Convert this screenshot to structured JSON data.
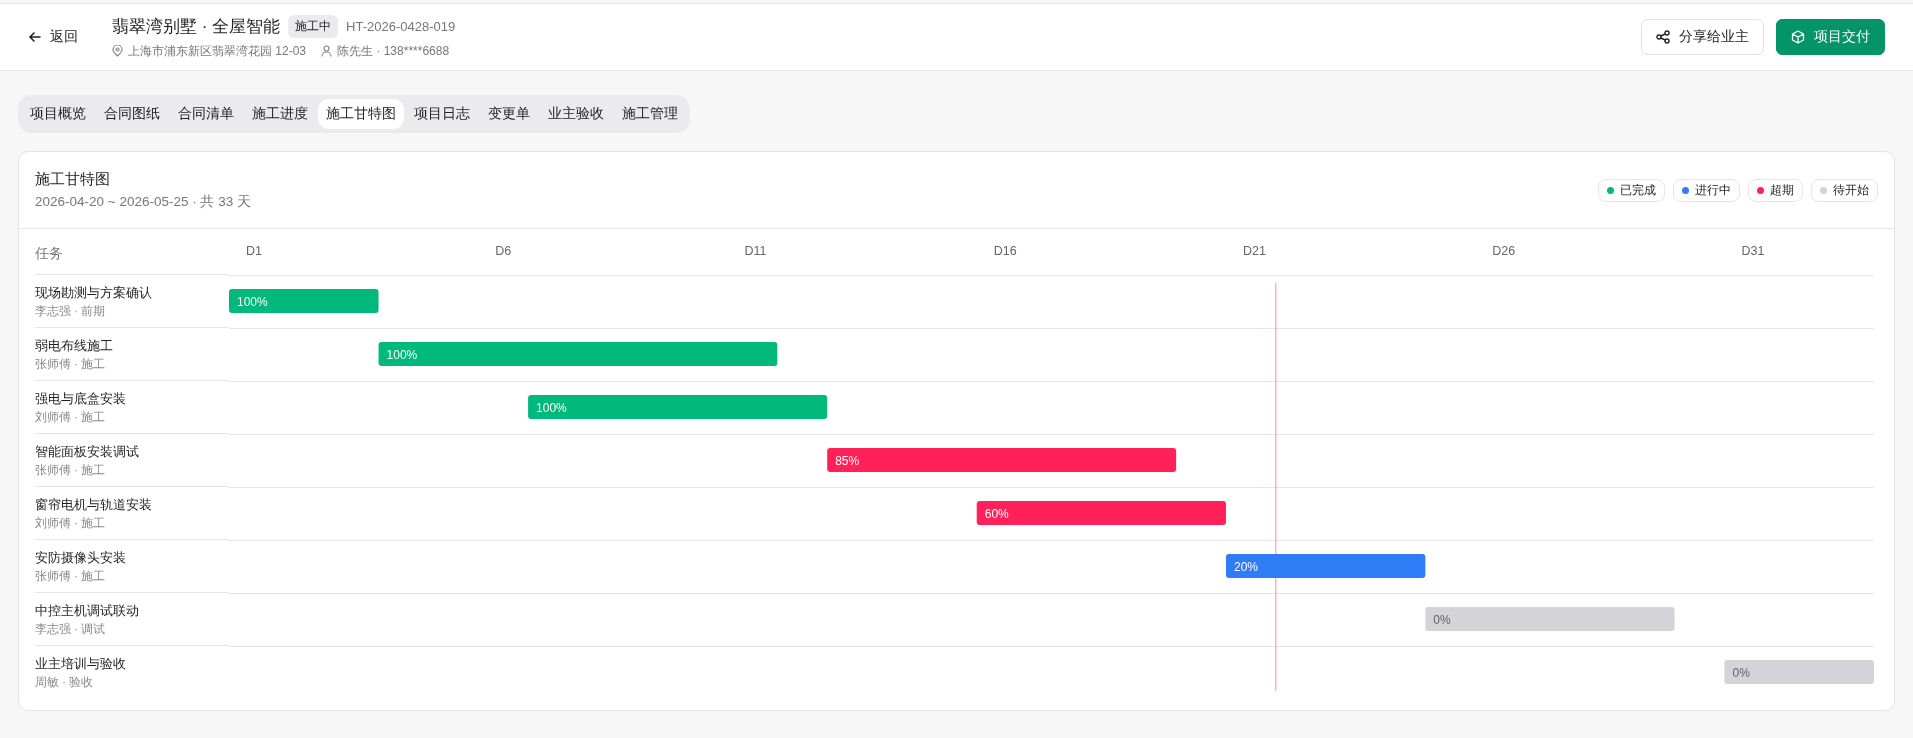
{
  "header": {
    "back_label": "返回",
    "title": "翡翠湾别墅 · 全屋智能",
    "status_badge": "施工中",
    "code": "HT-2026-0428-019",
    "address": "上海市浦东新区翡翠湾花园 12-03",
    "contact": "陈先生 · 138****6688",
    "share_button": "分享给业主",
    "deliver_button": "项目交付"
  },
  "tabs": [
    {
      "label": "项目概览",
      "selected": false
    },
    {
      "label": "合同图纸",
      "selected": false
    },
    {
      "label": "合同清单",
      "selected": false
    },
    {
      "label": "施工进度",
      "selected": false
    },
    {
      "label": "施工甘特图",
      "selected": true
    },
    {
      "label": "项目日志",
      "selected": false
    },
    {
      "label": "变更单",
      "selected": false
    },
    {
      "label": "业主验收",
      "selected": false
    },
    {
      "label": "施工管理",
      "selected": false
    }
  ],
  "gantt": {
    "title": "施工甘特图",
    "range": "2026-04-20 ~ 2026-05-25 · 共 33 天",
    "legend": [
      {
        "label": "已完成",
        "color": "#00b97a"
      },
      {
        "label": "进行中",
        "color": "#2f7cf6"
      },
      {
        "label": "超期",
        "color": "#ff2158"
      },
      {
        "label": "待开始",
        "color": "#d4d4d8"
      }
    ],
    "task_header": "任务",
    "day_labels": [
      "D1",
      "D6",
      "D11",
      "D16",
      "D21",
      "D26",
      "D31"
    ],
    "tasks": [
      {
        "name": "现场勘测与方案确认",
        "meta": "李志强 · 前期",
        "color": "#00b97a",
        "progress_label": "100%"
      },
      {
        "name": "弱电布线施工",
        "meta": "张师傅 · 施工",
        "color": "#00b97a",
        "progress_label": "100%"
      },
      {
        "name": "强电与底盒安装",
        "meta": "刘师傅 · 施工",
        "color": "#00b97a",
        "progress_label": "100%"
      },
      {
        "name": "智能面板安装调试",
        "meta": "张师傅 · 施工",
        "color": "#ff2158",
        "progress_label": "85%"
      },
      {
        "name": "窗帘电机与轨道安装",
        "meta": "刘师傅 · 施工",
        "color": "#ff2158",
        "progress_label": "60%"
      },
      {
        "name": "安防摄像头安装",
        "meta": "张师傅 · 施工",
        "color": "#2f7cf6",
        "progress_label": "20%"
      },
      {
        "name": "中控主机调试联动",
        "meta": "李志强 · 调试",
        "color": "#d4d4d8",
        "progress_label": "0%"
      },
      {
        "name": "业主培训与验收",
        "meta": "周敏 · 验收",
        "color": "#d4d4d8",
        "progress_label": "0%"
      }
    ]
  }
}
